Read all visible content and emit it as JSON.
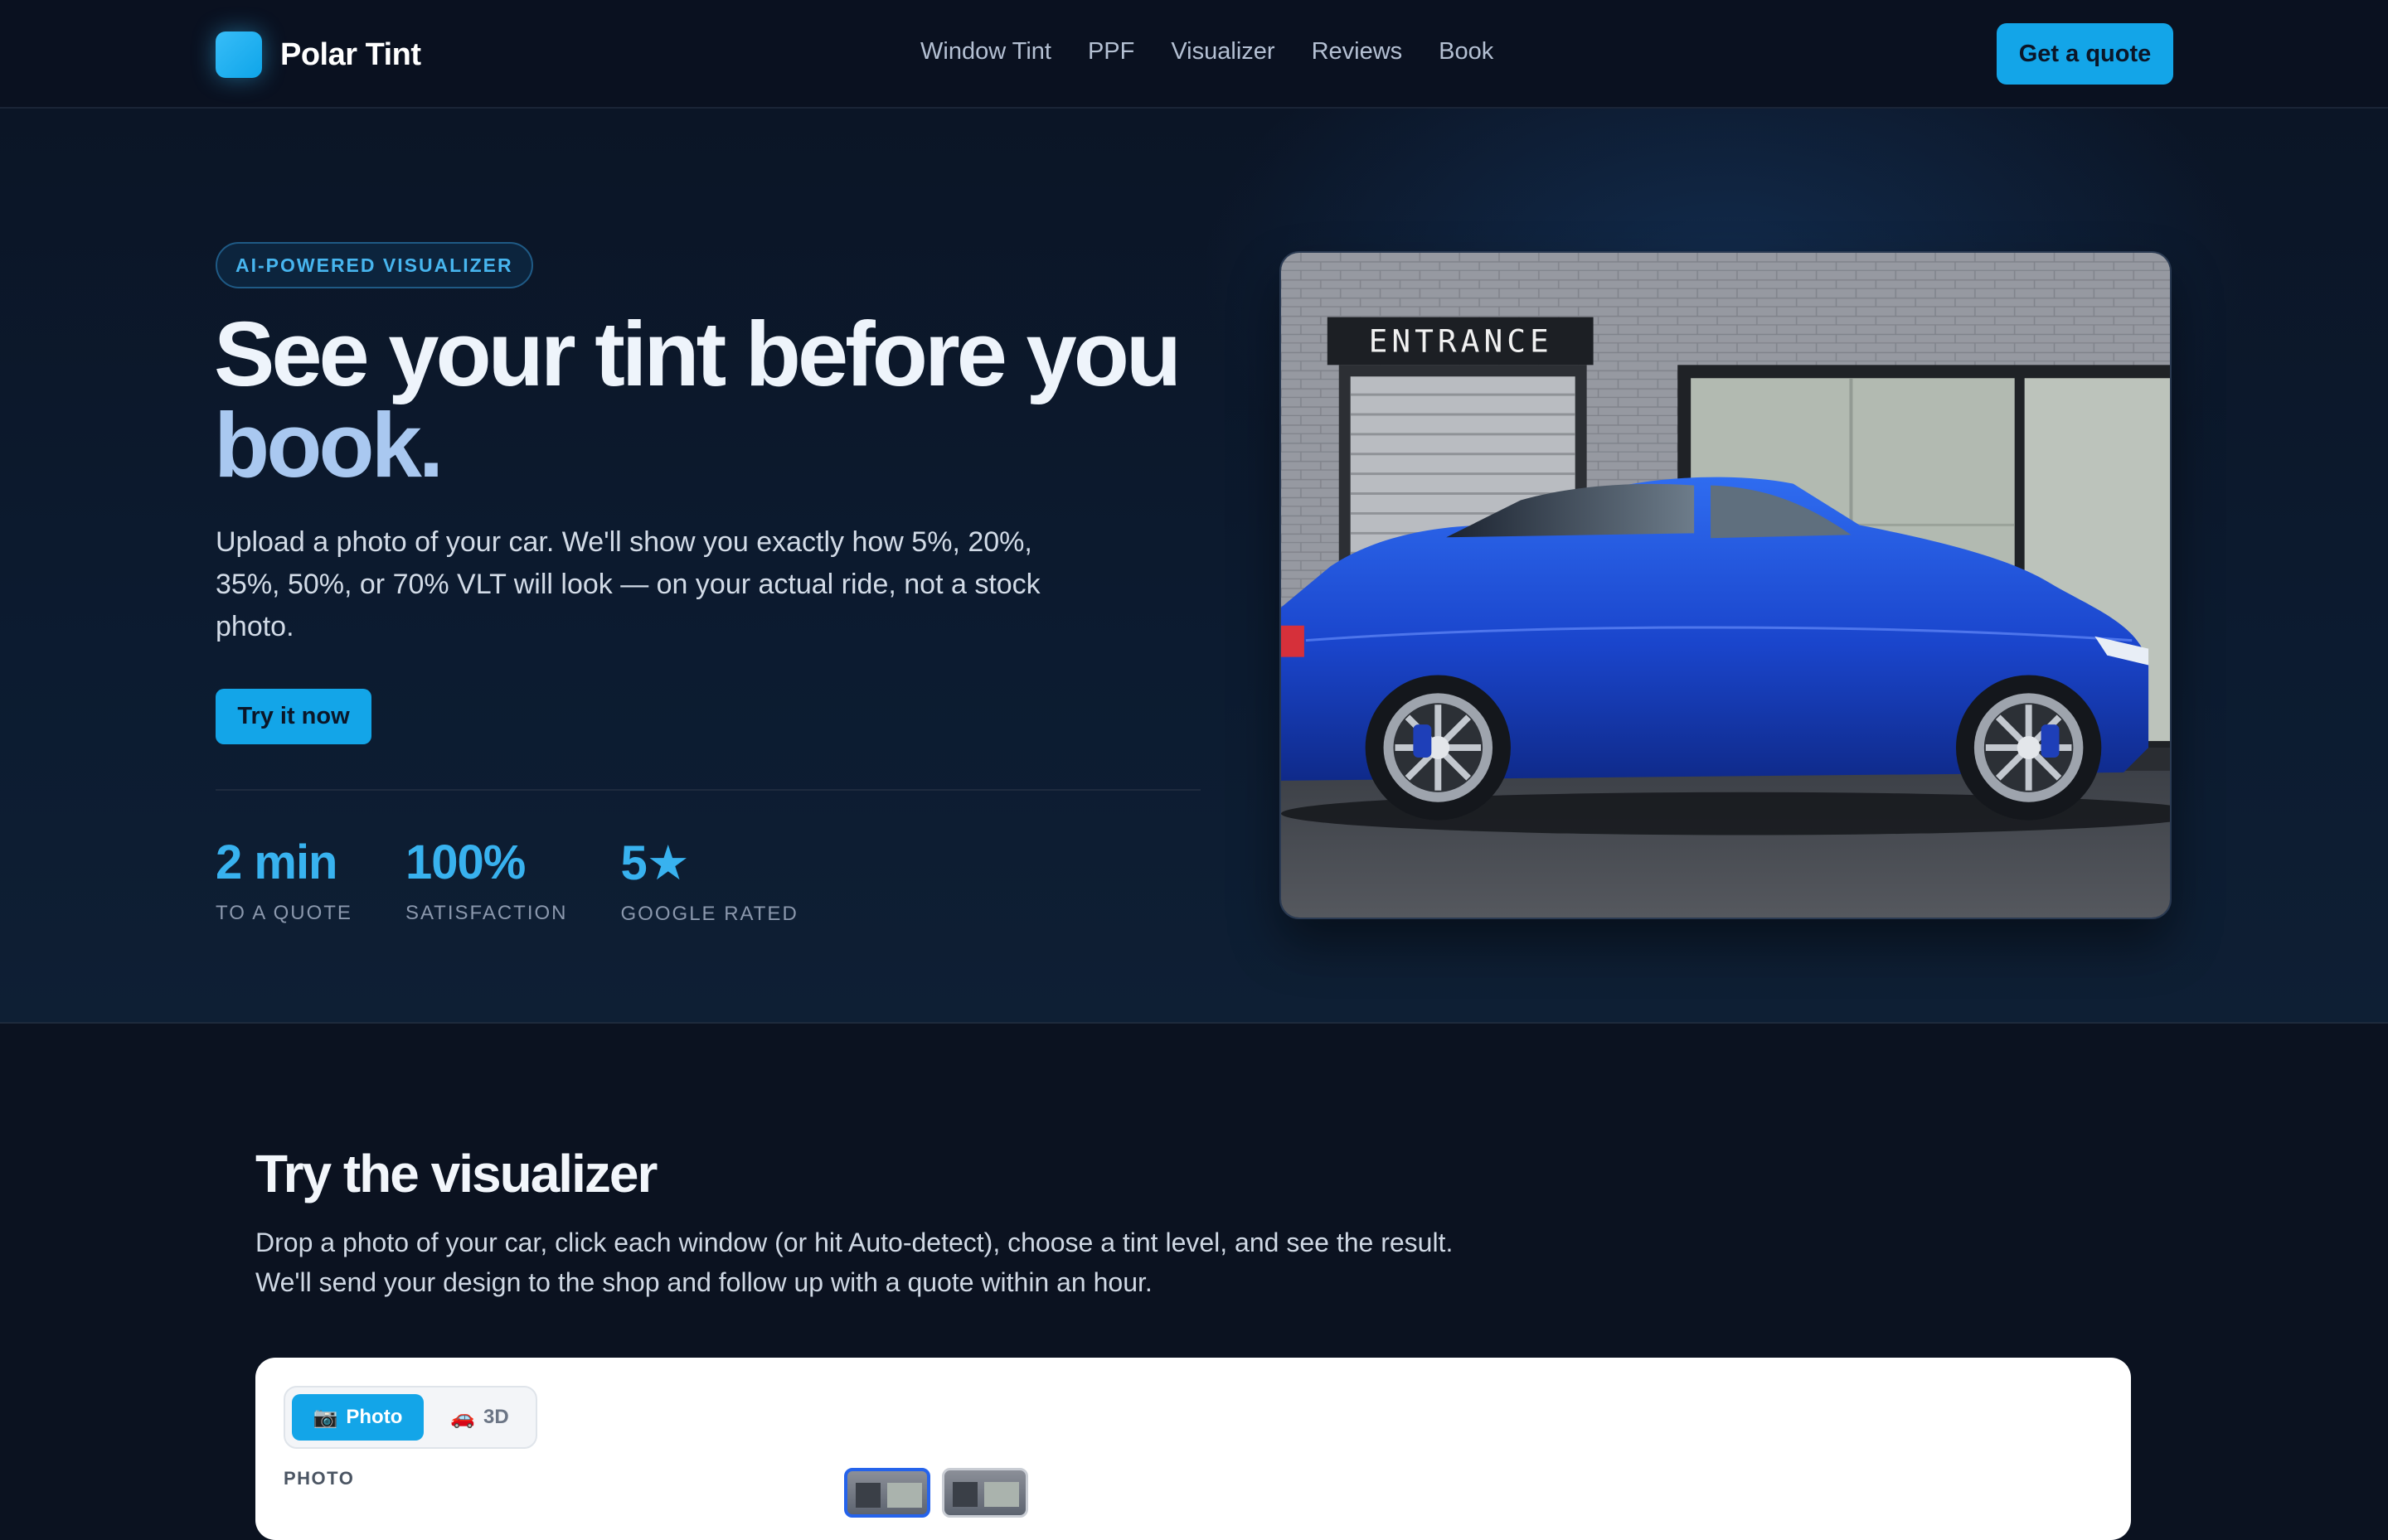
{
  "nav": {
    "brand": "Polar Tint",
    "links": [
      "Window Tint",
      "PPF",
      "Visualizer",
      "Reviews",
      "Book"
    ],
    "cta": "Get a quote"
  },
  "hero": {
    "badge": "AI-POWERED VISUALIZER",
    "title_line1": "See your tint before you",
    "title_line2": "book.",
    "subtitle": "Upload a photo of your car. We'll show you exactly how 5%, 20%, 35%, 50%, or 70% VLT will look — on your actual ride, not a stock photo.",
    "cta": "Try it now",
    "stats": [
      {
        "value": "2 min",
        "label": "TO A QUOTE"
      },
      {
        "value": "100%",
        "label": "SATISFACTION"
      },
      {
        "value": "5★",
        "label": "GOOGLE RATED"
      }
    ],
    "image": {
      "sign_text": "ENTRANCE",
      "car_color": "#1d4fd8"
    }
  },
  "visualizer": {
    "title": "Try the visualizer",
    "subtitle": "Drop a photo of your car, click each window (or hit Auto-detect), choose a tint level, and see the result. We'll send your design to the shop and follow up with a quote within an hour.",
    "modes": [
      {
        "icon": "📷",
        "label": "Photo",
        "active": true
      },
      {
        "icon": "🚗",
        "label": "3D",
        "active": false
      }
    ],
    "photo_label": "PHOTO"
  },
  "colors": {
    "accent": "#13a5e8",
    "stat": "#38b2ef",
    "background": "#0b1220"
  }
}
